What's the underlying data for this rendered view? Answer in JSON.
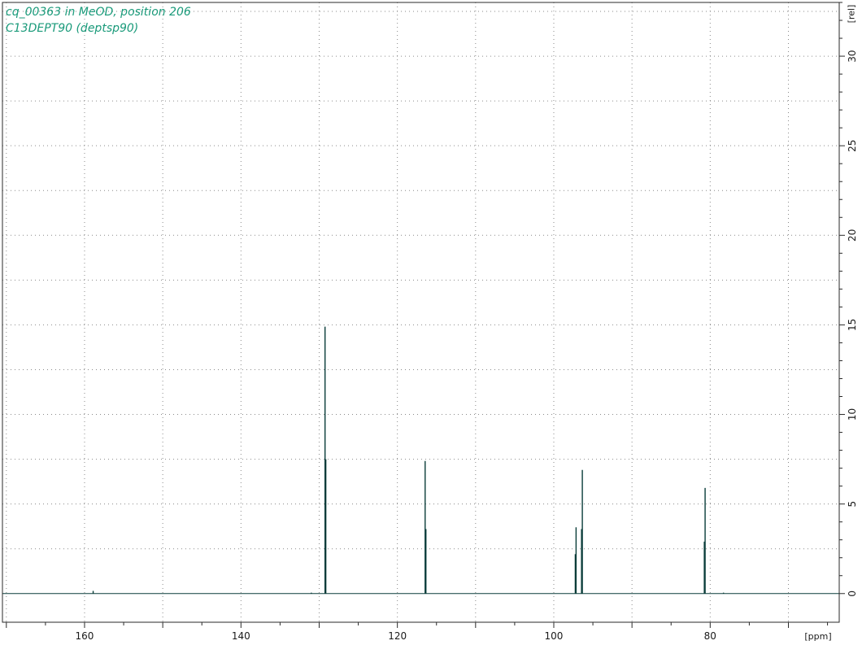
{
  "header": {
    "line1": "cq_00363 in MeOD, position 206",
    "line2": "C13DEPT90 (deptsp90)"
  },
  "colors": {
    "spectrum": "#0a3d3a",
    "title": "#1a9a7a",
    "grid": "#8a8a8a",
    "frame": "#2a2a2a"
  },
  "chart_data": {
    "type": "line",
    "title": "cq_00363 in MeOD, position 206",
    "subtitle": "C13DEPT90 (deptsp90)",
    "xlabel": "[ppm]",
    "ylabel": "[rel]",
    "x_reversed": true,
    "xlim": [
      170.5,
      63.5
    ],
    "ylim": [
      -1.6,
      33
    ],
    "grid": true,
    "x_ticks": [
      160,
      140,
      120,
      100,
      80
    ],
    "x_tick_labels": [
      "160",
      "140",
      "120",
      "100",
      "80"
    ],
    "y_ticks": [
      0,
      5,
      10,
      15,
      20,
      25,
      30
    ],
    "y_tick_labels": [
      "0",
      "5",
      "10",
      "15",
      "20",
      "25",
      "30"
    ],
    "peaks": [
      {
        "ppm": 158.9,
        "intensity": 0.15
      },
      {
        "ppm": 131.0,
        "intensity": 0.05
      },
      {
        "ppm": 129.25,
        "intensity": 14.9
      },
      {
        "ppm": 129.15,
        "intensity": 7.5
      },
      {
        "ppm": 116.45,
        "intensity": 7.4
      },
      {
        "ppm": 116.35,
        "intensity": 3.6
      },
      {
        "ppm": 97.15,
        "intensity": 3.7
      },
      {
        "ppm": 97.25,
        "intensity": 2.2
      },
      {
        "ppm": 96.35,
        "intensity": 6.9
      },
      {
        "ppm": 96.45,
        "intensity": 3.6
      },
      {
        "ppm": 80.65,
        "intensity": 5.9
      },
      {
        "ppm": 80.75,
        "intensity": 2.9
      },
      {
        "ppm": 78.3,
        "intensity": 0.05
      }
    ]
  }
}
